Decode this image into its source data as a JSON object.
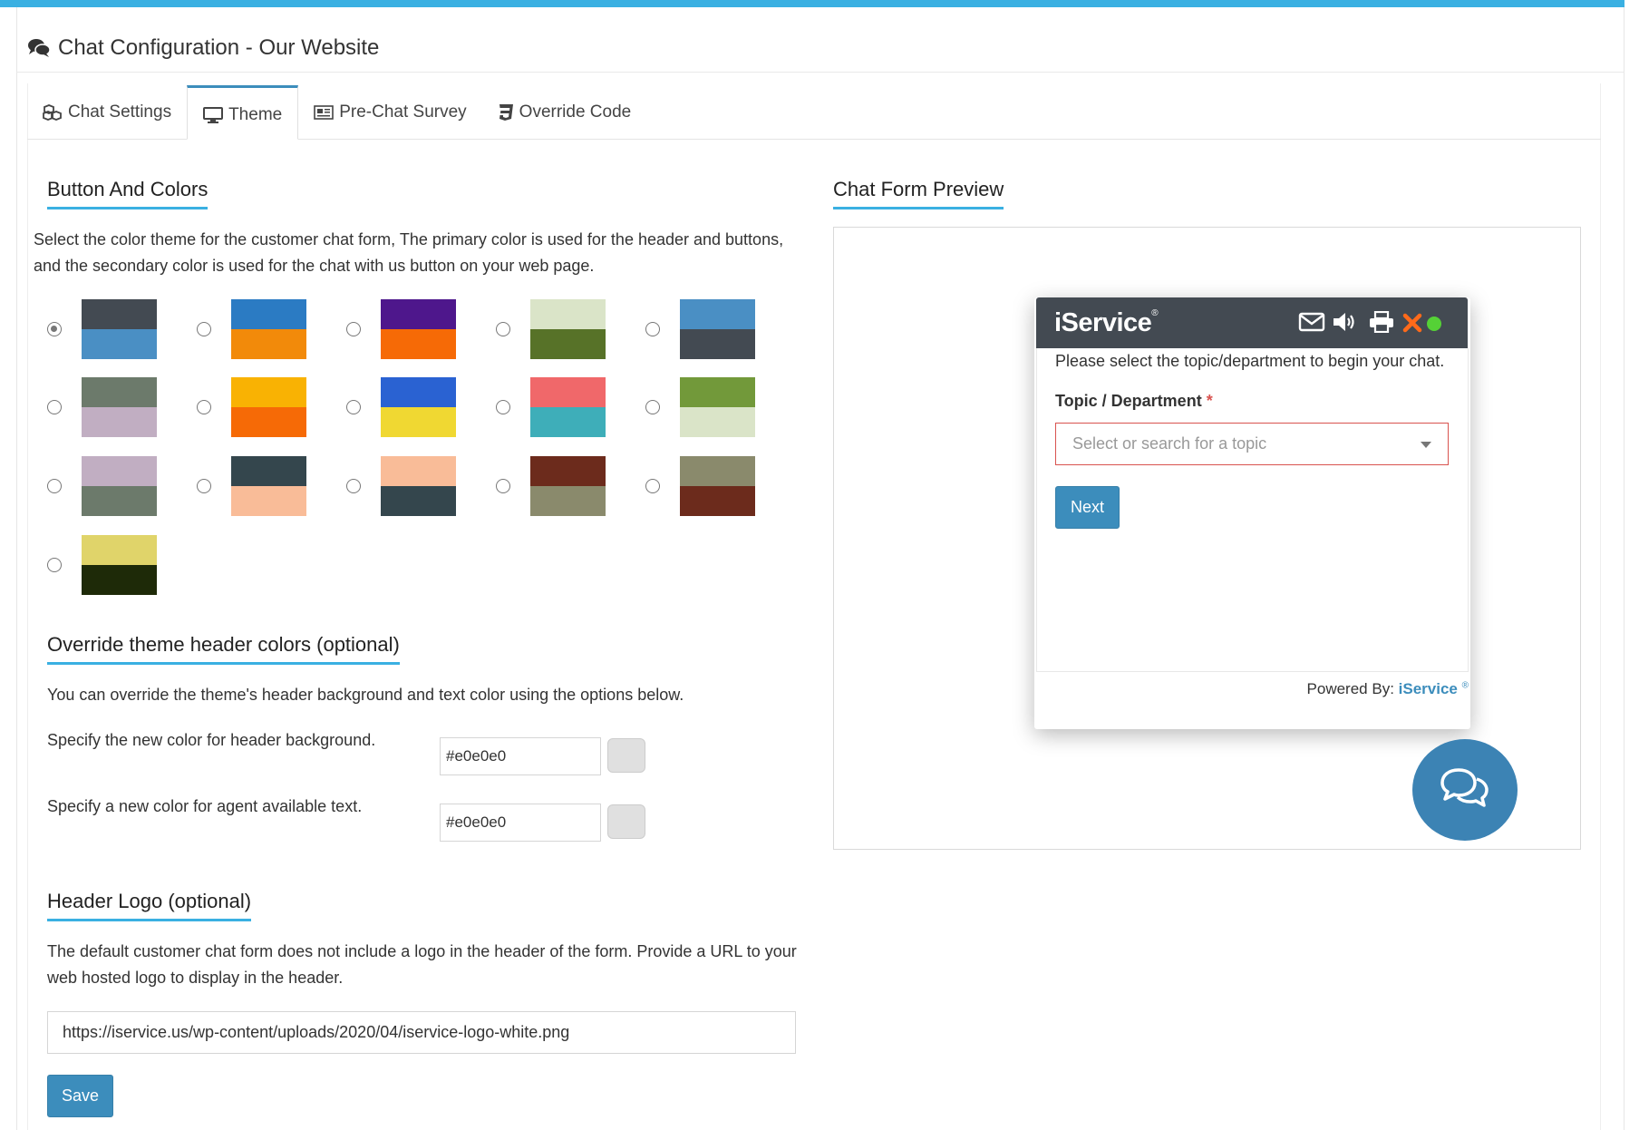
{
  "page": {
    "title": "Chat Configuration - Our Website"
  },
  "tabs": [
    {
      "label": "Chat Settings",
      "icon": "cubes-icon",
      "active": false
    },
    {
      "label": "Theme",
      "icon": "monitor-icon",
      "active": true
    },
    {
      "label": "Pre-Chat Survey",
      "icon": "newspaper-icon",
      "active": false
    },
    {
      "label": "Override Code",
      "icon": "css3-icon",
      "active": false
    }
  ],
  "colors_section": {
    "title": "Button And Colors",
    "description_line1": "Select the color theme for the customer chat form, The primary color is used for the header and buttons,",
    "description_line2": "and the secondary color is used for the chat with us button on your web page.",
    "selected_index": 0,
    "themes": [
      {
        "primary": "#434a52",
        "secondary": "#4a8fc4"
      },
      {
        "primary": "#2b7bc3",
        "secondary": "#f28a0a"
      },
      {
        "primary": "#4e178c",
        "secondary": "#f66a06"
      },
      {
        "primary": "#dae4c8",
        "secondary": "#577228"
      },
      {
        "primary": "#4a8fc4",
        "secondary": "#434a52"
      },
      {
        "primary": "#6c7a6b",
        "secondary": "#c1aec2"
      },
      {
        "primary": "#f9b203",
        "secondary": "#f66a06"
      },
      {
        "primary": "#2a62d2",
        "secondary": "#f0d832"
      },
      {
        "primary": "#f0686a",
        "secondary": "#3eaeb9"
      },
      {
        "primary": "#72993a",
        "secondary": "#dae4c8"
      },
      {
        "primary": "#c1aec2",
        "secondary": "#6c7a6b"
      },
      {
        "primary": "#34464d",
        "secondary": "#f9bc98"
      },
      {
        "primary": "#f9bc98",
        "secondary": "#34464d"
      },
      {
        "primary": "#6c2b1c",
        "secondary": "#8a8a6c"
      },
      {
        "primary": "#8a8a6c",
        "secondary": "#6c2b1c"
      },
      {
        "primary": "#e0d46a",
        "secondary": "#1e2a08"
      }
    ]
  },
  "override_section": {
    "title": "Override theme header colors (optional)",
    "description": "You can override the theme's header background and text color using the options below.",
    "header_bg_label": "Specify the new color for header background.",
    "header_bg_value": "#e0e0e0",
    "agent_text_label": "Specify a new color for agent available text.",
    "agent_text_value": "#e0e0e0",
    "chip_color": "#e0e0e0"
  },
  "logo_section": {
    "title": "Header Logo (optional)",
    "description_line1": "The default customer chat form does not include a logo in the header of the form. Provide a URL to your",
    "description_line2": "web hosted logo to display in the header.",
    "logo_url": "https://iservice.us/wp-content/uploads/2020/04/iservice-logo-white.png",
    "save_label": "Save"
  },
  "preview": {
    "title": "Chat Form Preview",
    "brand": "iService",
    "brand_mark": "®",
    "header_color": "#434a52",
    "intro_text": "Please select the topic/department to begin your chat.",
    "topic_label": "Topic / Department",
    "required_mark": "*",
    "topic_placeholder": "Select or search for a topic",
    "next_label": "Next",
    "powered_by_label": "Powered By:",
    "powered_by_brand": "iService",
    "powered_by_mark": "®",
    "status_color": "#55d136",
    "close_color": "#ff6a1a"
  }
}
